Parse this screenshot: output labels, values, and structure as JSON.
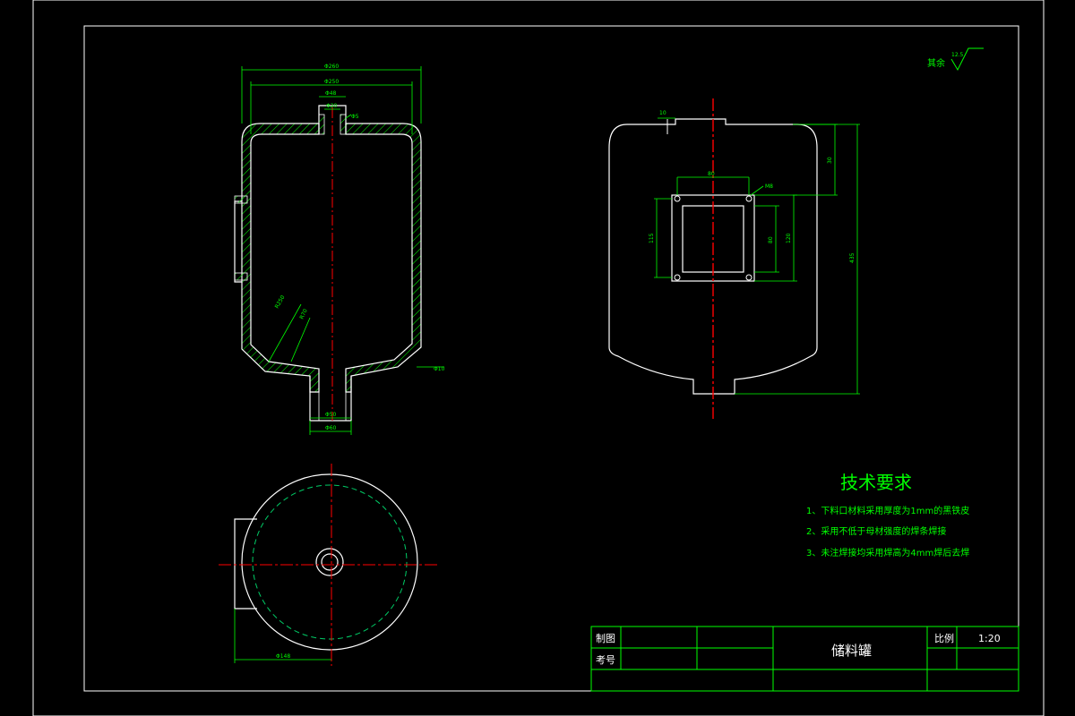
{
  "colors": {
    "background": "#000000",
    "outline": "#ffffff",
    "dimension": "#00ff00",
    "center_line": "#ff0000",
    "hatch": "#00ff00",
    "hidden": "#00cc66"
  },
  "roughness": {
    "label": "其余",
    "value": "12.5"
  },
  "front_view": {
    "dims": {
      "d_outer": "Φ260",
      "d_inner": "Φ250",
      "d_nozzle": "Φ48",
      "d_nozzle_in": "Φ20",
      "wall": "Φ5",
      "r_bottom": "R250",
      "r_bottom2": "R70",
      "bottom_right": "Φ10",
      "d_outlet_in": "Φ50",
      "d_outlet_out": "Φ60"
    }
  },
  "side_view": {
    "dims": {
      "top_gap": "10",
      "w_flange": "80",
      "hole": "M8",
      "h_top": "30",
      "h_total": "435",
      "h_window": "115",
      "h_inner": "80",
      "h_outer": "120"
    }
  },
  "bottom_view": {
    "dims": {
      "diameter": "Φ148"
    }
  },
  "requirements": {
    "title": "技术要求",
    "items": [
      "1、下料口材料采用厚度为1mm的黑铁皮",
      "2、采用不低于母材强度的焊条焊接",
      "3、未注焊接均采用焊高为4mm焊后去焊"
    ]
  },
  "title_block": {
    "drawn_label": "制图",
    "check_label": "考号",
    "drawing_name": "储料罐",
    "scale_label": "比例",
    "scale_value": "1:20"
  }
}
